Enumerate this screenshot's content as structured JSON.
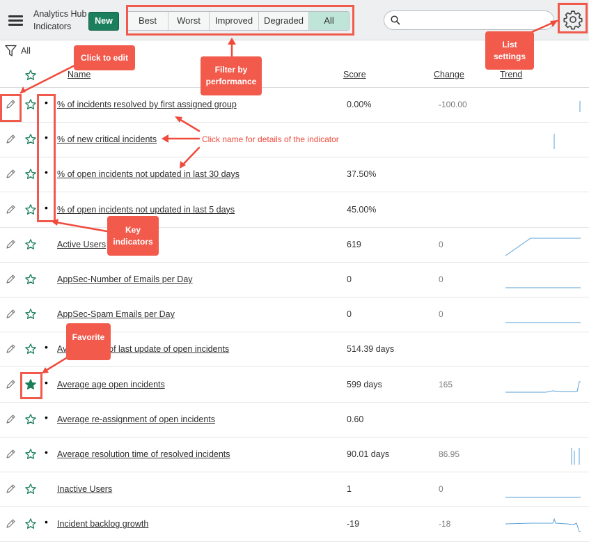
{
  "header": {
    "app_name": "Analytics Hub",
    "page_name": "Indicators",
    "new_label": "New",
    "filters": [
      {
        "label": "Best",
        "active": false
      },
      {
        "label": "Worst",
        "active": false
      },
      {
        "label": "Improved",
        "active": false
      },
      {
        "label": "Degraded",
        "active": false
      },
      {
        "label": "All",
        "active": true
      }
    ],
    "search_value": "",
    "search_icon": "magnifier-icon",
    "settings_icon": "gear-icon"
  },
  "filter_bar": {
    "label": "All",
    "icon": "funnel-icon"
  },
  "columns": {
    "name": "Name",
    "score": "Score",
    "change": "Change",
    "trend": "Trend"
  },
  "colors": {
    "accent": "#1b7f5d",
    "active_filter": "#bfe4d8",
    "annotation": "#f25a4c",
    "trend_line": "#5aa0d6"
  },
  "rows": [
    {
      "name": "% of incidents resolved by first assigned group",
      "score": "0.00%",
      "change": "-100.00",
      "key": true,
      "favorite": false,
      "trend": "tick-right"
    },
    {
      "name": "% of new critical incidents",
      "score": "",
      "change": "",
      "key": true,
      "favorite": false,
      "trend": "tick-mid"
    },
    {
      "name": "% of open incidents not updated in last 30 days",
      "score": "37.50%",
      "change": "",
      "key": true,
      "favorite": false,
      "trend": "none"
    },
    {
      "name": "% of open incidents not updated in last 5 days",
      "score": "45.00%",
      "change": "",
      "key": true,
      "favorite": false,
      "trend": "none"
    },
    {
      "name": "Active Users",
      "score": "619",
      "change": "0",
      "key": false,
      "favorite": false,
      "trend": "ramp"
    },
    {
      "name": "AppSec-Number of Emails per Day",
      "score": "0",
      "change": "0",
      "key": false,
      "favorite": false,
      "trend": "flat"
    },
    {
      "name": "AppSec-Spam Emails per Day",
      "score": "0",
      "change": "0",
      "key": false,
      "favorite": false,
      "trend": "flat"
    },
    {
      "name": "Average age of last update of open incidents",
      "score": "514.39 days",
      "change": "",
      "key": true,
      "favorite": false,
      "trend": "none"
    },
    {
      "name": "Average age open incidents",
      "score": "599 days",
      "change": "165",
      "key": true,
      "favorite": true,
      "trend": "spike-end"
    },
    {
      "name": "Average re-assignment of open incidents",
      "score": "0.60",
      "change": "",
      "key": true,
      "favorite": false,
      "trend": "none"
    },
    {
      "name": "Average resolution time of resolved incidents",
      "score": "90.01 days",
      "change": "86.95",
      "key": true,
      "favorite": false,
      "trend": "bars-end"
    },
    {
      "name": "Inactive Users",
      "score": "1",
      "change": "0",
      "key": false,
      "favorite": false,
      "trend": "flat"
    },
    {
      "name": "Incident backlog growth",
      "score": "-19",
      "change": "-18",
      "key": true,
      "favorite": false,
      "trend": "noisy"
    }
  ],
  "annotations": {
    "click_to_edit": "Click to edit",
    "filter_by": "Filter by",
    "performance": "performance",
    "list": "List",
    "settings": "settings",
    "click_name": "Click name for details of the indicator",
    "key": "Key",
    "indicators": "indicators",
    "favorite": "Favorite"
  }
}
